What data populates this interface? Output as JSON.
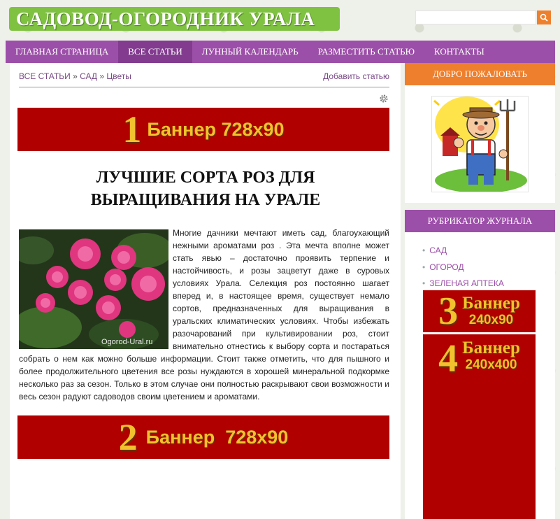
{
  "site": {
    "logo_text": "САДОВОД-ОГОРОДНИК УРАЛА"
  },
  "search": {
    "placeholder": ""
  },
  "nav": {
    "items": [
      {
        "label": "ГЛАВНАЯ СТРАНИЦА"
      },
      {
        "label": "ВСЕ СТАТЬИ"
      },
      {
        "label": "ЛУННЫЙ КАЛЕНДАРЬ"
      },
      {
        "label": "РАЗМЕСТИТЬ СТАТЬЮ"
      },
      {
        "label": "КОНТАКТЫ"
      }
    ],
    "active_index": 1
  },
  "breadcrumb": {
    "items": [
      "ВСЕ СТАТЬИ",
      "САД",
      "Цветы"
    ],
    "separator": "»"
  },
  "add_article_link": "Добавить статью",
  "banners": {
    "top": {
      "number": "1",
      "text": "Баннер 728х90"
    },
    "bottom": {
      "number": "2",
      "text": "Баннер  728х90"
    },
    "side1": {
      "number": "3",
      "line1": "Баннер",
      "line2": "240х90"
    },
    "side2": {
      "number": "4",
      "line1": "Баннер",
      "line2": "240х400"
    }
  },
  "article": {
    "title": "ЛУЧШИЕ СОРТА РОЗ ДЛЯ ВЫРАЩИВАНИЯ НА УРАЛЕ",
    "image_watermark": "Ogorod-Ural.ru",
    "body": "Многие дачники мечтают иметь сад, благоухающий нежными ароматами роз . Эта мечта вполне может стать явью – достаточно проявить терпение и настойчивость, и розы зацветут даже в суровых условиях Урала. Селекция роз постоянно шагает вперед и, в настоящее время, существует немало сортов, предназначенных для выращивания в уральских климатических условиях. Чтобы избежать разочарований при культивировании роз, стоит внимательно отнестись к выбору сорта и постараться собрать о нем как можно больше информации. Стоит также отметить, что для пышного и более продолжительного цветения все розы нуждаются в хорошей минеральной подкормке несколько раз за сезон. Только в этом случае они полностью раскрывают свои возможности и весь сезон радуют садоводов своим цветением и ароматами."
  },
  "sidebar": {
    "welcome_title": "ДОБРО ПОЖАЛОВАТЬ",
    "rubricator_title": "РУБРИКАТОР ЖУРНАЛА",
    "categories": [
      "САД",
      "ОГОРОД",
      "ЗЕЛЕНАЯ АПТЕКА"
    ]
  },
  "colors": {
    "nav_bg": "#9c4fa8",
    "nav_active": "#823b8f",
    "logo_green": "#7fc241",
    "banner_red": "#b10000",
    "banner_gold": "#f2c12e",
    "welcome_orange": "#ee7f2d",
    "link_purple": "#7a4b87"
  }
}
